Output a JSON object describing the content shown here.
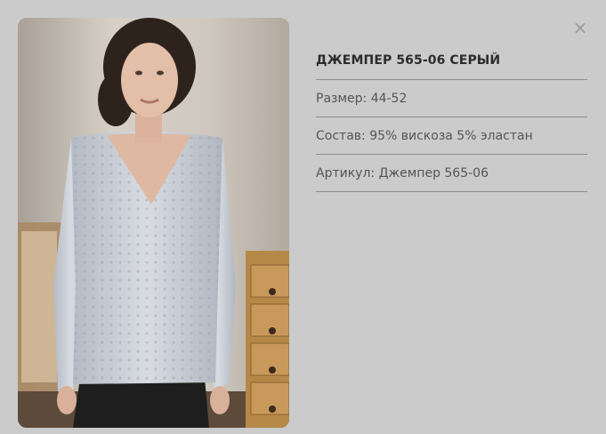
{
  "product": {
    "title": "ДЖЕМПЕР 565-06 СЕРЫЙ",
    "size": "Размер: 44-52",
    "composition": "Состав: 95% вискоза 5% эластан",
    "article": "Артикул: Джемпер 565-06"
  },
  "close": {
    "label": "×"
  },
  "image": {
    "subject": "woman-in-grey-jumper"
  },
  "colors": {
    "background": "#cbcbcb",
    "title": "#2c2c2c",
    "text": "#555555",
    "divider": "#8e8e8e",
    "close": "#9a9a9a"
  }
}
